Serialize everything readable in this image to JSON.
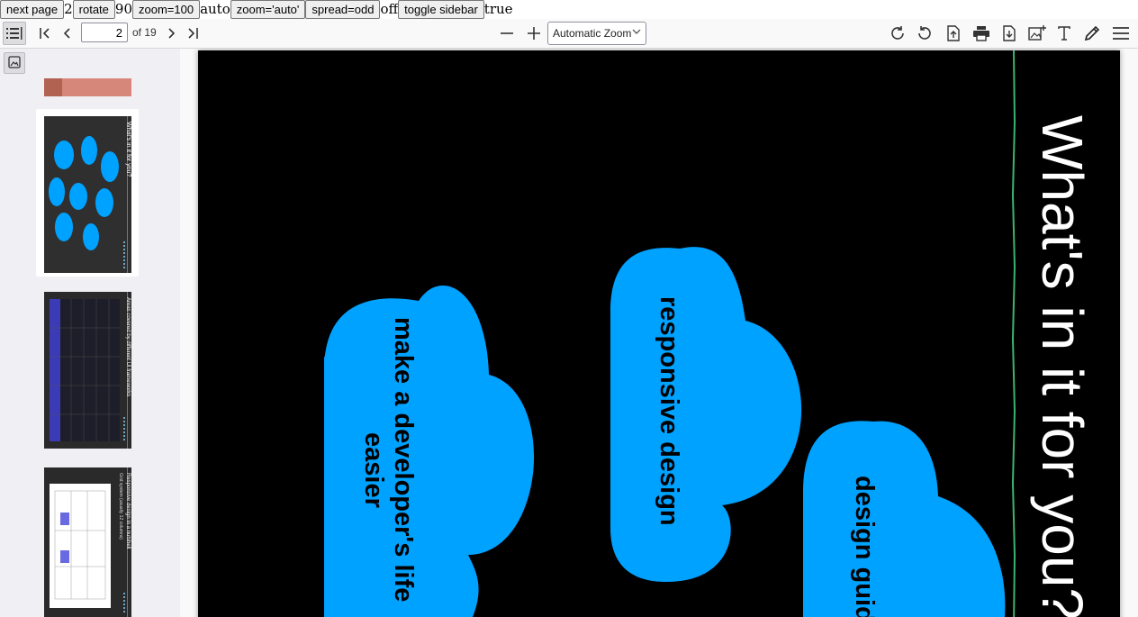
{
  "debug": {
    "next_page": "next page",
    "page_value": "2",
    "rotate": "rotate",
    "rotate_value": "90",
    "zoom100": "zoom=100",
    "zoom_value": "auto",
    "zoom_auto": "zoom='auto'",
    "spread": "spread=odd",
    "spread_value": "off",
    "toggle_sidebar": "toggle sidebar",
    "sidebar_value": "true"
  },
  "toolbar": {
    "page_number": "2",
    "page_count": "of 19",
    "zoom_label": "Automatic Zoom",
    "icons": [
      "sidebar-toggle-icon",
      "first-page-icon",
      "previous-page-icon",
      "next-page-icon",
      "last-page-icon",
      "zoom-out-icon",
      "zoom-in-icon",
      "rotate-cw-icon",
      "rotate-ccw-icon",
      "open-file-icon",
      "print-icon",
      "download-icon",
      "add-image-icon",
      "text-icon",
      "draw-icon",
      "menu-icon"
    ]
  },
  "slide": {
    "title": "What's in it for you?",
    "bubbles": [
      {
        "line1": "make a developer's life",
        "line2": "easier"
      },
      {
        "line1": "responsive design"
      },
      {
        "line1": "design guid"
      }
    ],
    "colors": {
      "bubble": "#00a2ff",
      "background": "#000000",
      "accent_line": "#3cb371"
    }
  },
  "thumbnails": [
    {
      "title": "What's in it for you?"
    },
    {
      "title": "Areas covered by different UI frameworks"
    },
    {
      "title": "Responsive design in a nutshell",
      "subtitle": "Grid system (usually 12 columns)"
    }
  ]
}
